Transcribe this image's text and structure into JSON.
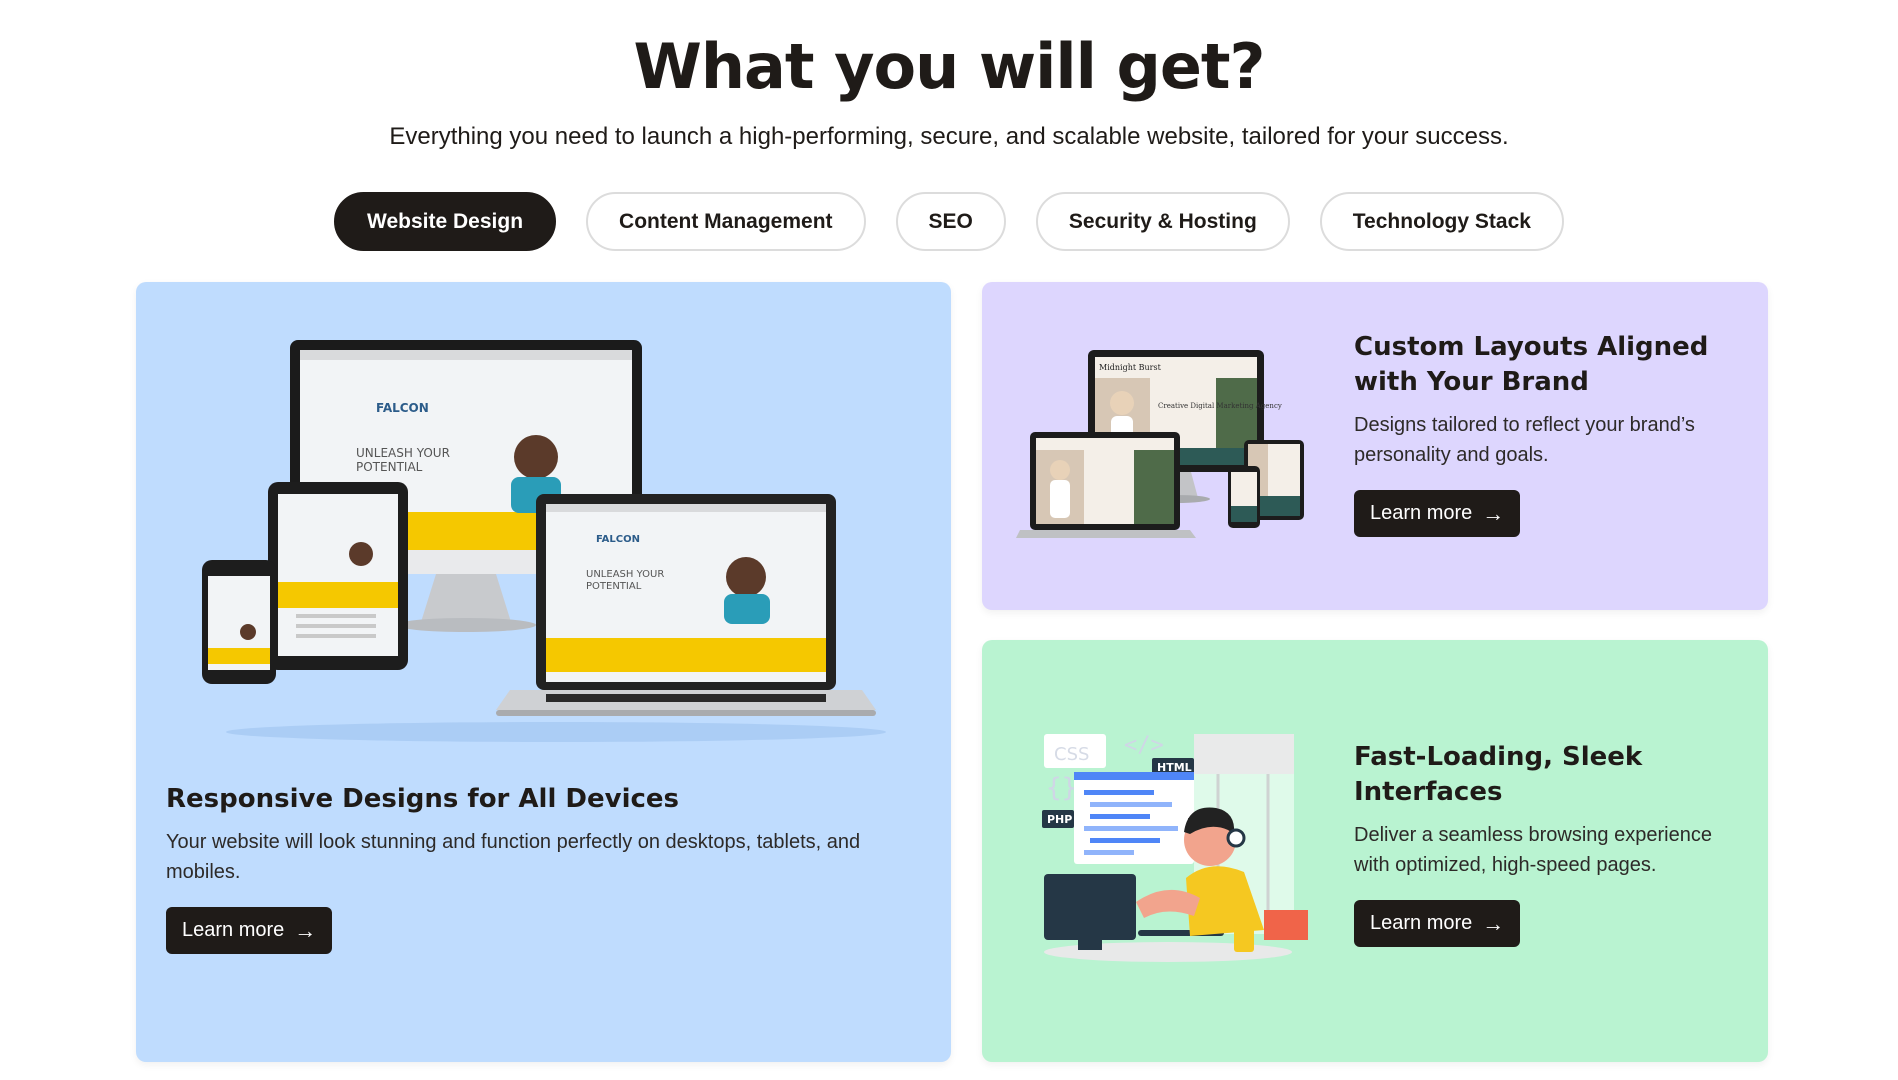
{
  "header": {
    "title": "What you will get?",
    "subtitle": "Everything you need to launch a high-performing, secure, and scalable website, tailored for your success."
  },
  "tabs": [
    {
      "label": "Website Design",
      "active": true
    },
    {
      "label": "Content Management",
      "active": false
    },
    {
      "label": "SEO",
      "active": false
    },
    {
      "label": "Security & Hosting",
      "active": false
    },
    {
      "label": "Technology Stack",
      "active": false
    }
  ],
  "cards": {
    "responsive": {
      "title": "Responsive Designs for All Devices",
      "description": "Your website will look stunning and function perfectly on desktops, tablets, and mobiles.",
      "button": "Learn more",
      "bg": "#bfdcfe",
      "mockup": {
        "brand": "FALCON",
        "headline_1": "UNLEASH YOUR",
        "headline_2": "POTENTIAL"
      }
    },
    "custom_layouts": {
      "title": "Custom Layouts Aligned with Your Brand",
      "description": "Designs tailored to reflect your brand’s personality and goals.",
      "button": "Learn more",
      "bg": "#ddd6fe",
      "mockup": {
        "brand": "Midnight Burst",
        "headline": "Creative Digital Marketing Agency"
      }
    },
    "fast_loading": {
      "title": "Fast-Loading, Sleek Interfaces",
      "description": "Deliver a seamless browsing experience with optimized, high-speed pages.",
      "button": "Learn more",
      "bg": "#b9f3d1",
      "tags": [
        "CSS",
        "HTML",
        "PHP"
      ]
    }
  },
  "colors": {
    "dark": "#1f1b18",
    "accent_yellow": "#f5c800"
  },
  "icons": {
    "arrow": "→"
  }
}
